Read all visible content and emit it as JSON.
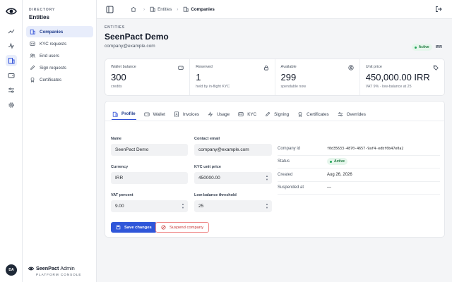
{
  "brand": {
    "name_bold": "SeenPact",
    "name_light": "Admin",
    "subtitle": "PLATFORM CONSOLE"
  },
  "user": {
    "initials": "DA"
  },
  "sidebar": {
    "kicker": "DIRECTORY",
    "title": "Entities",
    "items": [
      {
        "label": "Companies",
        "icon": "building-icon",
        "active": true
      },
      {
        "label": "KYC requests",
        "icon": "id-card-icon",
        "active": false
      },
      {
        "label": "End users",
        "icon": "users-icon",
        "active": false
      },
      {
        "label": "Sign requests",
        "icon": "pen-icon",
        "active": false
      },
      {
        "label": "Certificates",
        "icon": "certificate-icon",
        "active": false
      }
    ]
  },
  "rail": {
    "icons": [
      "eye-logo-icon",
      "chart-icon",
      "activity-icon",
      "building-icon",
      "wallet-icon",
      "sliders-icon",
      "settings-icon"
    ]
  },
  "breadcrumb": {
    "home_icon": "home-icon",
    "parent": "Entities",
    "current": "Companies"
  },
  "header": {
    "kicker": "ENTITIES",
    "title": "SeenPact Demo",
    "email": "company@example.com",
    "status": "Active",
    "currency": "IRR"
  },
  "stats": [
    {
      "label": "Wallet balance",
      "value": "300",
      "sub": "credits",
      "icon": "wallet-icon"
    },
    {
      "label": "Reserved",
      "value": "1",
      "sub": "held by in-flight KYC",
      "icon": "lock-icon"
    },
    {
      "label": "Available",
      "value": "299",
      "sub": "spendable now",
      "icon": "coin-icon"
    },
    {
      "label": "Unit price",
      "value": "450,000.00 IRR",
      "sub": "VAT 9% · low-balance at 25",
      "icon": "tag-icon"
    }
  ],
  "tabs": [
    {
      "label": "Profile",
      "icon": "building-icon",
      "active": true
    },
    {
      "label": "Wallet",
      "icon": "wallet-icon",
      "active": false
    },
    {
      "label": "Invoices",
      "icon": "receipt-icon",
      "active": false
    },
    {
      "label": "Usage",
      "icon": "activity-icon",
      "active": false
    },
    {
      "label": "KYC",
      "icon": "id-card-icon",
      "active": false
    },
    {
      "label": "Signing",
      "icon": "pen-icon",
      "active": false
    },
    {
      "label": "Certificates",
      "icon": "certificate-icon",
      "active": false
    },
    {
      "label": "Overrides",
      "icon": "sliders-icon",
      "active": false
    }
  ],
  "form": {
    "name": {
      "label": "Name",
      "value": "SeenPact Demo"
    },
    "contact_email": {
      "label": "Contact email",
      "value": "company@example.com"
    },
    "currency": {
      "label": "Currency",
      "value": "IRR"
    },
    "kyc_unit_price": {
      "label": "KYC unit price",
      "value": "450000.00"
    },
    "vat_percent": {
      "label": "VAT percent",
      "value": "9.00"
    },
    "low_balance": {
      "label": "Low-balance threshold",
      "value": "25"
    }
  },
  "info": {
    "company_id": {
      "label": "Company id",
      "value": "f0d35633-4870-4657-9af4-edbf0b47e0a2"
    },
    "status": {
      "label": "Status",
      "value": "Active"
    },
    "created": {
      "label": "Created",
      "value": "Aug 26, 2026"
    },
    "suspended": {
      "label": "Suspended at",
      "value": "—"
    }
  },
  "actions": {
    "save": "Save changes",
    "suspend": "Suspend company"
  },
  "colors": {
    "accent": "#2f56d9",
    "danger": "#c53030",
    "success": "#1e7a3f"
  }
}
